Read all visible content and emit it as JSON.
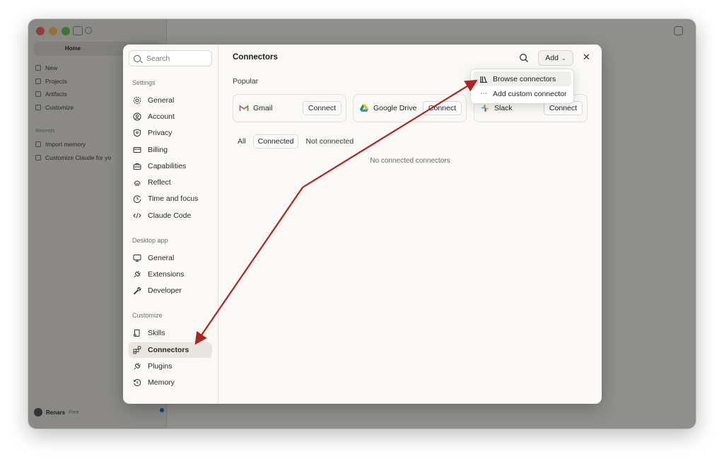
{
  "background": {
    "home_tab": "Home",
    "nav_items": [
      "New",
      "Projects",
      "Artifacts",
      "Customize"
    ],
    "recents_heading": "Recents",
    "recents": [
      "Import memory",
      "Customize Claude for yo"
    ],
    "user_name": "Renars",
    "user_plan": "Free"
  },
  "settings_nav": {
    "search_placeholder": "Search",
    "sections": [
      {
        "heading": "Settings",
        "items": [
          {
            "label": "General",
            "icon": "gear-icon"
          },
          {
            "label": "Account",
            "icon": "user-circle-icon"
          },
          {
            "label": "Privacy",
            "icon": "shield-icon"
          },
          {
            "label": "Billing",
            "icon": "credit-card-icon"
          },
          {
            "label": "Capabilities",
            "icon": "toolbox-icon"
          },
          {
            "label": "Reflect",
            "icon": "reflect-icon"
          },
          {
            "label": "Time and focus",
            "icon": "clock-icon"
          },
          {
            "label": "Claude Code",
            "icon": "code-icon"
          }
        ]
      },
      {
        "heading": "Desktop app",
        "items": [
          {
            "label": "General",
            "icon": "monitor-icon"
          },
          {
            "label": "Extensions",
            "icon": "plug-icon"
          },
          {
            "label": "Developer",
            "icon": "wrench-icon"
          }
        ]
      },
      {
        "heading": "Customize",
        "items": [
          {
            "label": "Skills",
            "icon": "scroll-icon"
          },
          {
            "label": "Connectors",
            "icon": "connectors-icon",
            "active": true
          },
          {
            "label": "Plugins",
            "icon": "plug-icon"
          },
          {
            "label": "Memory",
            "icon": "history-icon"
          }
        ]
      }
    ]
  },
  "main": {
    "title": "Connectors",
    "add_label": "Add",
    "popular_label": "Popular",
    "connectors": [
      {
        "name": "Gmail",
        "button": "Connect",
        "icon": "gmail-icon"
      },
      {
        "name": "Google Drive",
        "button": "Connect",
        "icon": "google-drive-icon"
      },
      {
        "name": "Slack",
        "button": "Connect",
        "icon": "slack-icon"
      }
    ],
    "filter_tabs": [
      {
        "label": "All",
        "active": false
      },
      {
        "label": "Connected",
        "active": true
      },
      {
        "label": "Not connected",
        "active": false
      }
    ],
    "empty_message": "No connected connectors"
  },
  "add_menu": {
    "items": [
      {
        "label": "Browse connectors",
        "icon": "library-icon",
        "hovered": true
      },
      {
        "label": "Add custom connector",
        "icon": "more-dots-icon",
        "hovered": false
      }
    ]
  },
  "colors": {
    "annotation_arrow": "#b0241d",
    "active_nav_bg": "#e8e6df",
    "dialog_bg": "#faf9f5"
  }
}
